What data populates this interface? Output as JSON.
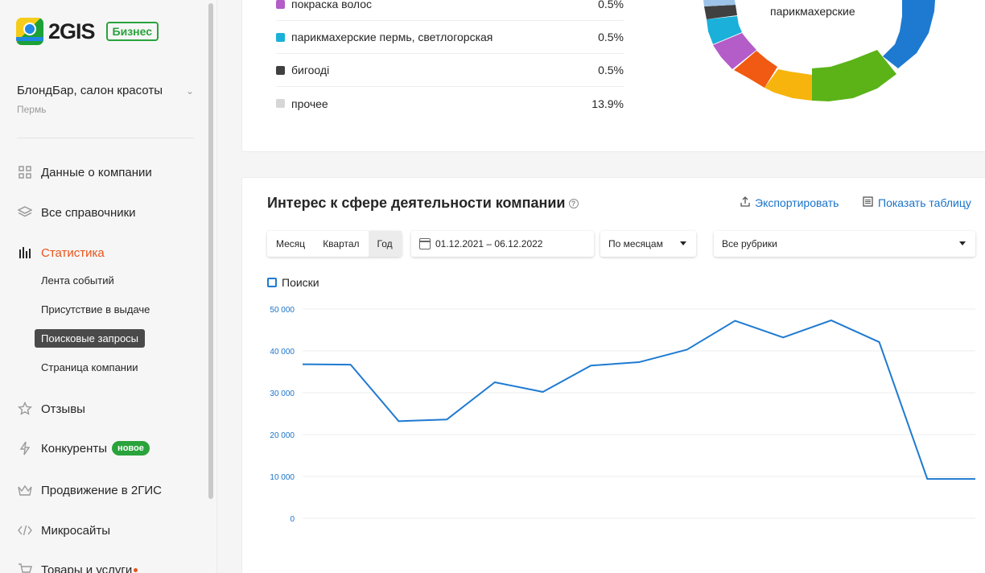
{
  "sidebar": {
    "logo_text": "2GIS",
    "business_badge": "Бизнес",
    "company_name": "БлондБар, салон красоты",
    "company_city": "Пермь",
    "nav": {
      "company_data": "Данные о компании",
      "directories": "Все справочники",
      "statistics": "Статистика",
      "reviews": "Отзывы",
      "competitors": "Конкуренты",
      "competitors_badge": "новое",
      "promotion": "Продвижение в 2ГИС",
      "microsites": "Микросайты",
      "goods": "Товары и услуги"
    },
    "stats_sub": {
      "events": "Лента событий",
      "presence": "Присутствие в выдаче",
      "search_queries": "Поисковые запросы",
      "company_page": "Страница компании"
    }
  },
  "category_legend": [
    {
      "label": "покраска волос",
      "value": "0.5%",
      "color": "#b45cc8"
    },
    {
      "label": "парикмахерские пермь, светлогорская",
      "value": "0.5%",
      "color": "#1ab0d9"
    },
    {
      "label": "бигоодi",
      "value": "0.5%",
      "color": "#404040"
    },
    {
      "label": "прочее",
      "value": "13.9%",
      "color": "#d6d6d6"
    }
  ],
  "donut_center_label": "парикмахерские",
  "interest": {
    "title": "Интерес к сфере деятельности компании",
    "export_label": "Экспортировать",
    "table_label": "Показать таблицу",
    "period_tabs": [
      "Месяц",
      "Квартал",
      "Год"
    ],
    "active_tab": "Год",
    "date_range": "01.12.2021 – 06.12.2022",
    "grouping": "По месяцам",
    "rubric": "Все рубрики"
  },
  "chart_data": {
    "type": "line",
    "series": [
      {
        "name": "Поиски",
        "color": "#1e7ad1",
        "values": [
          36800,
          36700,
          23200,
          23600,
          32500,
          30200,
          36500,
          37300,
          40300,
          47200,
          43200,
          47300,
          42100,
          9400,
          9400
        ]
      }
    ],
    "y_ticks": [
      "50 000",
      "40 000",
      "30 000",
      "20 000",
      "10 000",
      "0"
    ],
    "ylim": [
      0,
      50000
    ],
    "grid": true,
    "legend": "top-left"
  }
}
